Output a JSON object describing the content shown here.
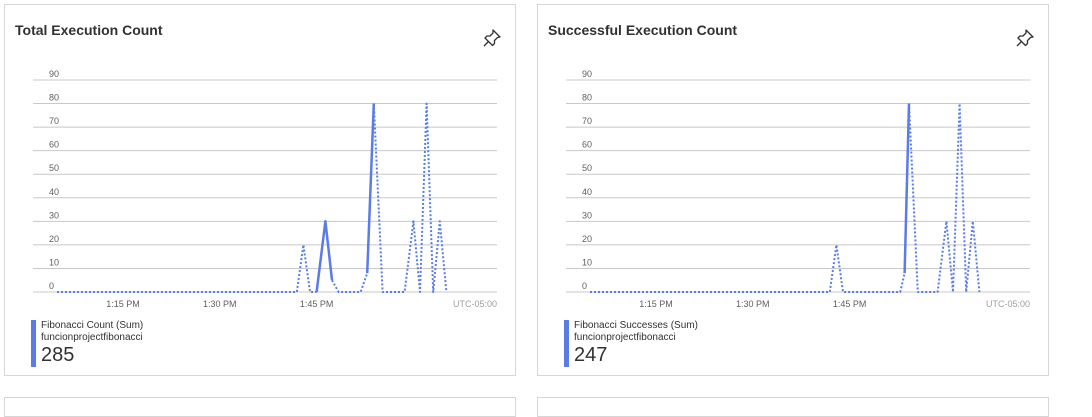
{
  "colors": {
    "series": "#5b7be6",
    "grid": "#c8c8c8",
    "tick": "#605e5c",
    "border": "#d6d6d6"
  },
  "icons": {
    "pin": "pin-icon"
  },
  "chart_data": [
    {
      "type": "line",
      "title": "Total Execution Count",
      "ylim": [
        0,
        90
      ],
      "yticks": [
        0,
        10,
        20,
        30,
        40,
        50,
        60,
        70,
        80,
        90
      ],
      "xlim": [
        0,
        100
      ],
      "xticks": [
        {
          "label": "1:15 PM",
          "x": 15
        },
        {
          "label": "1:30 PM",
          "x": 37
        },
        {
          "label": "1:45 PM",
          "x": 59
        }
      ],
      "timezone": "UTC-05:00",
      "grid": true,
      "series": [
        {
          "name": "Fibonacci Count (Sum)",
          "resource": "funcionprojectfibonacci",
          "total": "285",
          "segments": [
            {
              "style": "dotted",
              "points": [
                [
                  0,
                  0
                ],
                [
                  54.5,
                  0
                ],
                [
                  56,
                  20
                ],
                [
                  57.5,
                  0
                ],
                [
                  59,
                  0
                ]
              ]
            },
            {
              "style": "solid",
              "points": [
                [
                  59,
                  0
                ],
                [
                  61,
                  30
                ],
                [
                  62.5,
                  5
                ]
              ]
            },
            {
              "style": "dotted",
              "points": [
                [
                  62.5,
                  5
                ],
                [
                  64,
                  0
                ],
                [
                  69,
                  0
                ],
                [
                  70.5,
                  8
                ]
              ]
            },
            {
              "style": "solid",
              "points": [
                [
                  70.5,
                  8
                ],
                [
                  72,
                  80
                ]
              ]
            },
            {
              "style": "dotted",
              "points": [
                [
                  72,
                  80
                ],
                [
                  74,
                  0
                ],
                [
                  79,
                  0
                ],
                [
                  81,
                  30
                ],
                [
                  82.5,
                  0
                ],
                [
                  84,
                  80
                ],
                [
                  85.5,
                  0
                ],
                [
                  87,
                  30
                ],
                [
                  88.5,
                  0
                ]
              ]
            }
          ]
        }
      ]
    },
    {
      "type": "line",
      "title": "Successful Execution Count",
      "ylim": [
        0,
        90
      ],
      "yticks": [
        0,
        10,
        20,
        30,
        40,
        50,
        60,
        70,
        80,
        90
      ],
      "xlim": [
        0,
        100
      ],
      "xticks": [
        {
          "label": "1:15 PM",
          "x": 15
        },
        {
          "label": "1:30 PM",
          "x": 37
        },
        {
          "label": "1:45 PM",
          "x": 59
        }
      ],
      "timezone": "UTC-05:00",
      "grid": true,
      "series": [
        {
          "name": "Fibonacci Successes (Sum)",
          "resource": "funcionprojectfibonacci",
          "total": "247",
          "segments": [
            {
              "style": "dotted",
              "points": [
                [
                  0,
                  0
                ],
                [
                  54.5,
                  0
                ],
                [
                  56,
                  20
                ],
                [
                  57.5,
                  0
                ],
                [
                  70.5,
                  0
                ],
                [
                  71.5,
                  8
                ]
              ]
            },
            {
              "style": "solid",
              "points": [
                [
                  71.5,
                  8
                ],
                [
                  72.5,
                  80
                ]
              ]
            },
            {
              "style": "dotted",
              "points": [
                [
                  72.5,
                  80
                ],
                [
                  74.5,
                  0
                ],
                [
                  79,
                  0
                ],
                [
                  81,
                  30
                ],
                [
                  82.5,
                  0
                ],
                [
                  84,
                  80
                ],
                [
                  85.5,
                  0
                ],
                [
                  87,
                  30
                ],
                [
                  88.5,
                  0
                ]
              ]
            }
          ]
        }
      ]
    }
  ]
}
